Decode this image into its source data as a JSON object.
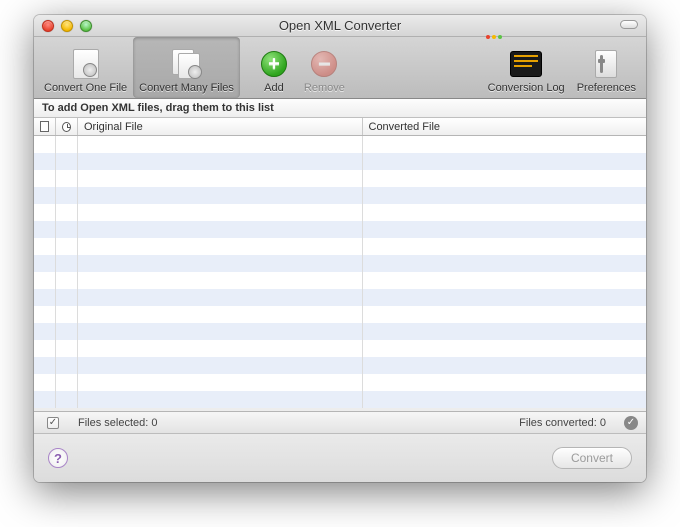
{
  "window": {
    "title": "Open XML Converter"
  },
  "toolbar": {
    "convert_one": "Convert One File",
    "convert_many": "Convert Many Files",
    "add": "Add",
    "remove": "Remove",
    "log": "Conversion Log",
    "prefs": "Preferences"
  },
  "instruction": "To add Open XML files, drag them to this list",
  "columns": {
    "original": "Original File",
    "converted": "Converted File"
  },
  "status": {
    "selected_label": "Files selected:",
    "selected_count": "0",
    "converted_label": "Files converted:",
    "converted_count": "0"
  },
  "bottom": {
    "convert": "Convert"
  }
}
